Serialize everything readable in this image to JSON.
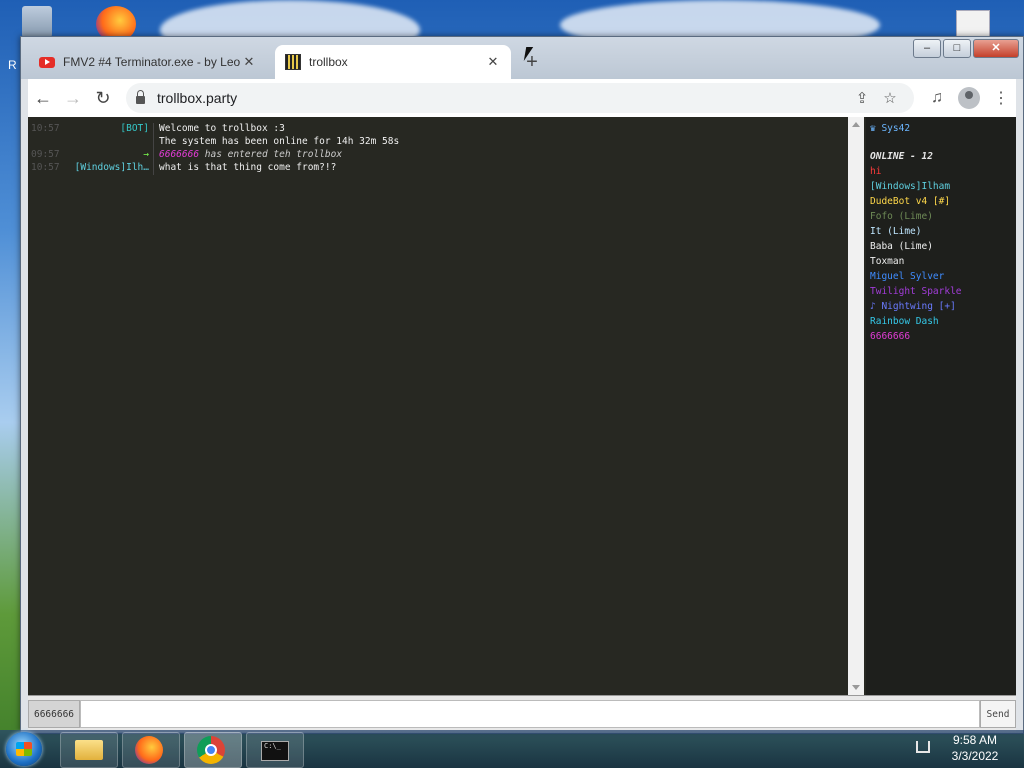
{
  "browser": {
    "tabs": [
      {
        "label": "FMV2 #4 Terminator.exe - by Leo",
        "icon": "youtube-icon",
        "active": false
      },
      {
        "label": "trollbox",
        "icon": "trollbox-favicon-icon",
        "active": true
      }
    ],
    "url": "trollbox.party",
    "new_tab_glyph": "+",
    "close_glyph": "✕"
  },
  "chat": {
    "messages": [
      {
        "time": "10:57",
        "nick": "[BOT]",
        "nick_color": "#35c9c9",
        "text": "Welcome to trollbox :3",
        "style": "normal"
      },
      {
        "time": "",
        "nick": "",
        "nick_color": "#35c9c9",
        "text": "The system has been online for 14h 32m 58s",
        "style": "normal"
      },
      {
        "time": "09:57",
        "nick": "→",
        "nick_color": "#7cff4f",
        "text_prefix": "6666666",
        "text_prefix_color": "#e23cd6",
        "text": " has entered teh trollbox",
        "style": "italic"
      },
      {
        "time": "10:57",
        "nick": "[Windows]Ilh…",
        "nick_color": "#5fd0e0",
        "text": "what is that thing come from?!?",
        "style": "normal"
      }
    ]
  },
  "sidebar": {
    "room": "♛ Sys42",
    "online_label": "ONLINE - 12",
    "users": [
      {
        "name": "hi",
        "color": "#ff3b3b"
      },
      {
        "name": "[Windows]Ilham",
        "color": "#5fd0e0"
      },
      {
        "name": "DudeBot v4 [#]",
        "color": "#ffd84a"
      },
      {
        "name": "Fofo (Lime)",
        "color": "#6e8a56"
      },
      {
        "name": "It (Lime)",
        "color": "#bfe6ff"
      },
      {
        "name": "Baba (Lime)",
        "color": "#f0f0f0"
      },
      {
        "name": "Toxman",
        "color": "#f0f0f0"
      },
      {
        "name": "Miguel Sylver",
        "color": "#3f8cff"
      },
      {
        "name": "Twilight Sparkle",
        "color": "#a23cd9"
      },
      {
        "name": "♪ Nightwing [+]",
        "color": "#6a7bff"
      },
      {
        "name": "Rainbow Dash",
        "color": "#35c9e9"
      },
      {
        "name": "6666666",
        "color": "#e23cd6"
      }
    ]
  },
  "input": {
    "nick": "6666666",
    "message_value": "",
    "send_label": "Send"
  },
  "taskbar": {
    "time": "9:58 AM",
    "date": "3/3/2022",
    "cmd_text": "C:\\_"
  },
  "desktop": {
    "edge_letter": "R"
  }
}
